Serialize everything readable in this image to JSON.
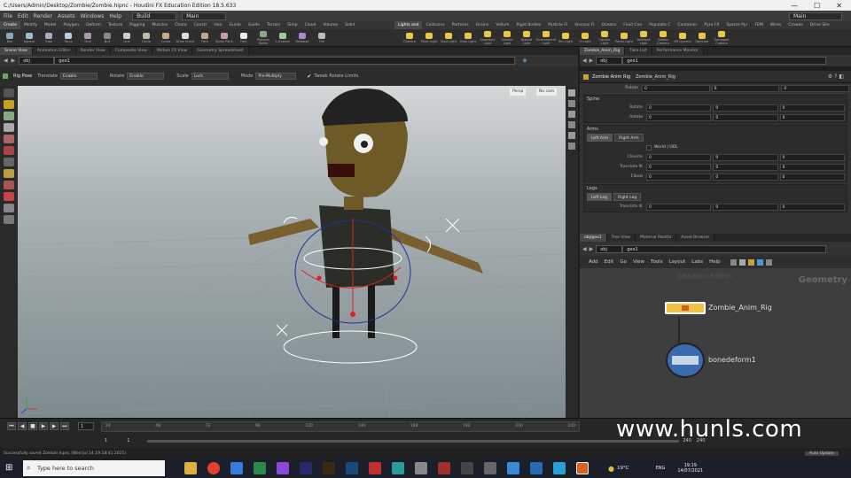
{
  "window": {
    "title": "C:/Users/Admin/Desktop/Zombie/Zombie.hipnc - Houdini FX Education Edition 18.5.633"
  },
  "menubar": {
    "items": [
      "File",
      "Edit",
      "Render",
      "Assets",
      "Windows",
      "Help"
    ],
    "build_desk": "Build",
    "main_desk": "Main",
    "right_desk": "Main"
  },
  "shelf": {
    "left_tabs": [
      "Create",
      "Modify",
      "Model",
      "Polygon",
      "Deform",
      "Texture",
      "Rigging",
      "Muscles",
      "Chara",
      "Constr",
      "Hair",
      "Guide",
      "Guide",
      "Terrain",
      "Simp",
      "Cloud",
      "Volume",
      "Solid"
    ],
    "right_tabs": [
      "Lights and",
      "Collisions",
      "Particles",
      "Grains",
      "Vellum",
      "Rigid Bodies",
      "Particle Fl",
      "Viscous Fl",
      "Oceans",
      "Fluid Con",
      "Populate C",
      "Container",
      "Pyro FX",
      "Sparse Pyr",
      "FEM",
      "Wires",
      "Crowds",
      "Drive Sim"
    ],
    "left_tools": [
      "Box",
      "Sphere",
      "Tube",
      "Torus",
      "Grid",
      "Null",
      "Line",
      "Circle",
      "Curve",
      "Draw Curve",
      "Path",
      "Spray Paint",
      "Font",
      "Platonic Solids",
      "L-System",
      "Metaball",
      "File"
    ],
    "right_tools": [
      "Camera",
      "Point Light",
      "Spot Light",
      "Area Light",
      "Geometry Light",
      "Volume Light",
      "Distant Light",
      "Environment Light",
      "Sky Light",
      "GI Light",
      "Caustic Light",
      "Portal Light",
      "Ambient Light",
      "Stereo Camera",
      "VR Camera",
      "Switcher",
      "Gamepad Camera"
    ]
  },
  "viewport": {
    "tabs": [
      "Scene View",
      "Animation Editor",
      "Render View",
      "Composite View",
      "Motion FX View",
      "Geometry Spreadsheet"
    ],
    "path": [
      "obj",
      "geo1"
    ],
    "options": {
      "title": "Rig Pose",
      "translate_label": "Translate",
      "translate_value": "Enable",
      "rotate_label": "Rotate",
      "rotate_value": "Enable",
      "scale_label": "Scale",
      "scale_value": "Lock",
      "mode_label": "Mode",
      "mode_value": "Pre-Multiply",
      "tweak_label": "Tweak Rotate Limits"
    },
    "camera_menu": "Persp",
    "cam_menu": "No cam"
  },
  "timeline": {
    "start_frame": "1",
    "end_frame": "1",
    "current_frame": "1",
    "ticks": [
      "24",
      "48",
      "72",
      "96",
      "120",
      "144",
      "168",
      "192",
      "216",
      "240"
    ],
    "range_end_a": "240",
    "range_end_b": "240"
  },
  "status": {
    "message": "Successfully saved Zombie.hipnc (Wed Jul 14 19:18:41 2021)",
    "auto_update": "Auto Update"
  },
  "params_pane": {
    "tabs": [
      "Zombie_Anim_Rig",
      "Take List",
      "Performance Monitor"
    ],
    "path": [
      "obj",
      "geo1"
    ],
    "node_type": "Zombie Anim Rig",
    "node_name": "Zombie_Anim_Rig",
    "rows_top": [
      {
        "label": "Rotate",
        "values": [
          "0",
          "0",
          "0"
        ]
      }
    ],
    "spine": {
      "title": "Spine",
      "rows": [
        {
          "label": "Rotate",
          "values": [
            "0",
            "0",
            "0"
          ]
        },
        {
          "label": "Rotate",
          "values": [
            "0",
            "0",
            "0"
          ]
        }
      ]
    },
    "arms": {
      "title": "Arms",
      "tabs": [
        "Left Arm",
        "Right Arm"
      ],
      "world_label": "World | ODL",
      "rows": [
        {
          "label": "Clavicle",
          "values": [
            "0",
            "0",
            "0"
          ]
        },
        {
          "label": "Translate IK",
          "values": [
            "0",
            "0",
            "0"
          ]
        },
        {
          "label": "Elbow",
          "values": [
            "0",
            "0",
            "0"
          ]
        }
      ]
    },
    "legs": {
      "title": "Legs",
      "tabs": [
        "Left Leg",
        "Right Leg"
      ],
      "rows": [
        {
          "label": "Translate IK",
          "values": [
            "0",
            "0",
            "0"
          ]
        }
      ]
    }
  },
  "network_pane": {
    "tabs": [
      "obj/geo1",
      "Tree View",
      "Material Palette",
      "Asset Browser"
    ],
    "path": [
      "obj",
      "geo1"
    ],
    "menu": [
      "Add",
      "Edit",
      "Go",
      "View",
      "Tools",
      "Layout",
      "Labs",
      "Help"
    ],
    "context_label": "Geometry",
    "ghost_label": "Education Edition",
    "nodes": [
      {
        "name": "Zombie_Anim_Rig"
      },
      {
        "name": "bonedeform1"
      }
    ]
  },
  "taskbar": {
    "search_placeholder": "Type here to search",
    "temp": "19°C",
    "lang": "ENG",
    "time": "19:19",
    "date": "14/07/2021"
  },
  "watermark": "www.hunls.com",
  "colors": {
    "viewport_top": "#d3d7d8",
    "viewport_bottom": "#7d8a8e",
    "selected_node": "#f0c040",
    "rig_red": "#e02020",
    "rig_blue": "#2030a0"
  }
}
